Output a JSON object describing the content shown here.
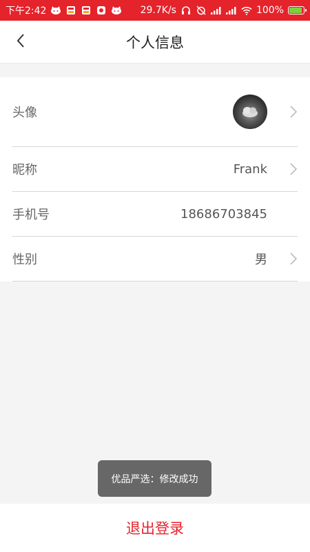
{
  "status_bar": {
    "time": "下午2:42",
    "notification_icons": [
      "cat-icon",
      "app-badge-icon",
      "app-badge-icon",
      "calendar-app-icon",
      "cat-icon"
    ],
    "network_speed": "29.7K/s",
    "battery_percent": "100%",
    "battery_level": 1.0,
    "background_color": "#e4232b"
  },
  "header": {
    "back_icon": "chevron-left-icon",
    "title": "个人信息"
  },
  "profile": {
    "avatar_label": "头像",
    "nickname_label": "昵称",
    "nickname_value": "Frank",
    "phone_label": "手机号",
    "phone_value": "18686703845",
    "gender_label": "性别",
    "gender_value": "男"
  },
  "toast": {
    "message": "优品严选：修改成功"
  },
  "footer": {
    "logout_label": "退出登录",
    "accent_color": "#e4232b"
  }
}
